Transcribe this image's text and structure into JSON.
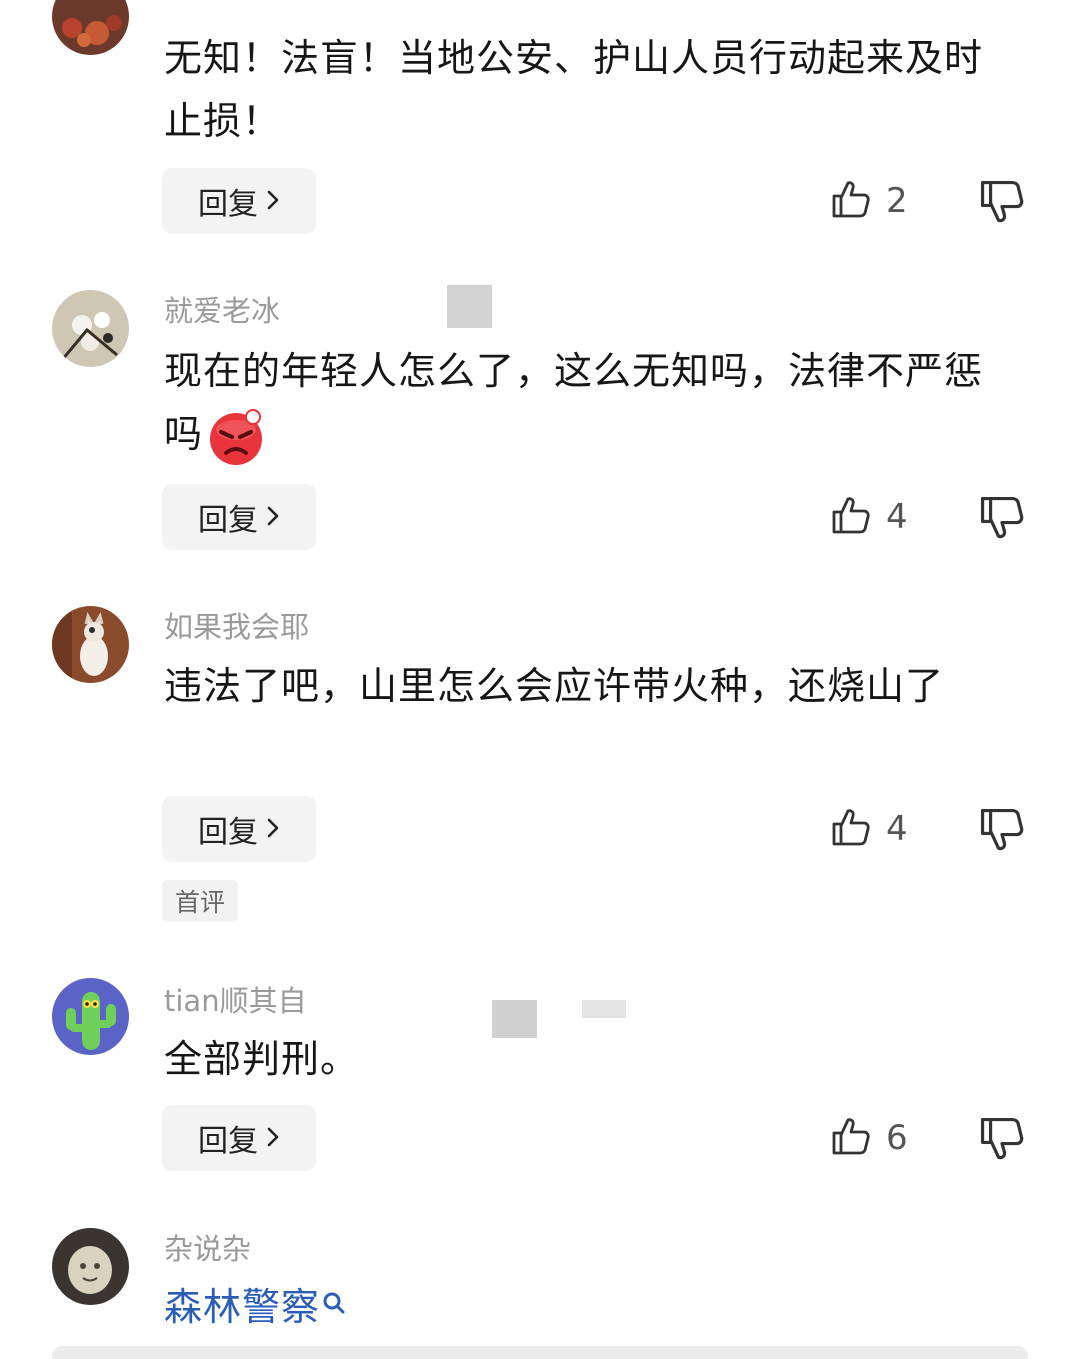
{
  "comments": [
    {
      "username": "",
      "text": "无知！法盲！当地公安、护山人员行动起来及时止损！",
      "reply_label": "回复",
      "likes": "2"
    },
    {
      "username": "就爱老冰",
      "text": "现在的年轻人怎么了，这么无知吗，法律不严惩吗",
      "emoji": "angry-face",
      "reply_label": "回复",
      "likes": "4"
    },
    {
      "username": "如果我会耶",
      "text": "违法了吧，山里怎么会应许带火种，还烧山了",
      "reply_label": "回复",
      "likes": "4",
      "badge": "首评"
    },
    {
      "username": "tian顺其自",
      "text": "全部判刑。",
      "reply_label": "回复",
      "likes": "6"
    },
    {
      "username": "杂说杂",
      "hashtag": "森林警察"
    }
  ],
  "colors": {
    "username": "#9a9a9a",
    "text": "#161616",
    "hashtag": "#2a5db8",
    "reply_bg": "#f3f3f3"
  }
}
